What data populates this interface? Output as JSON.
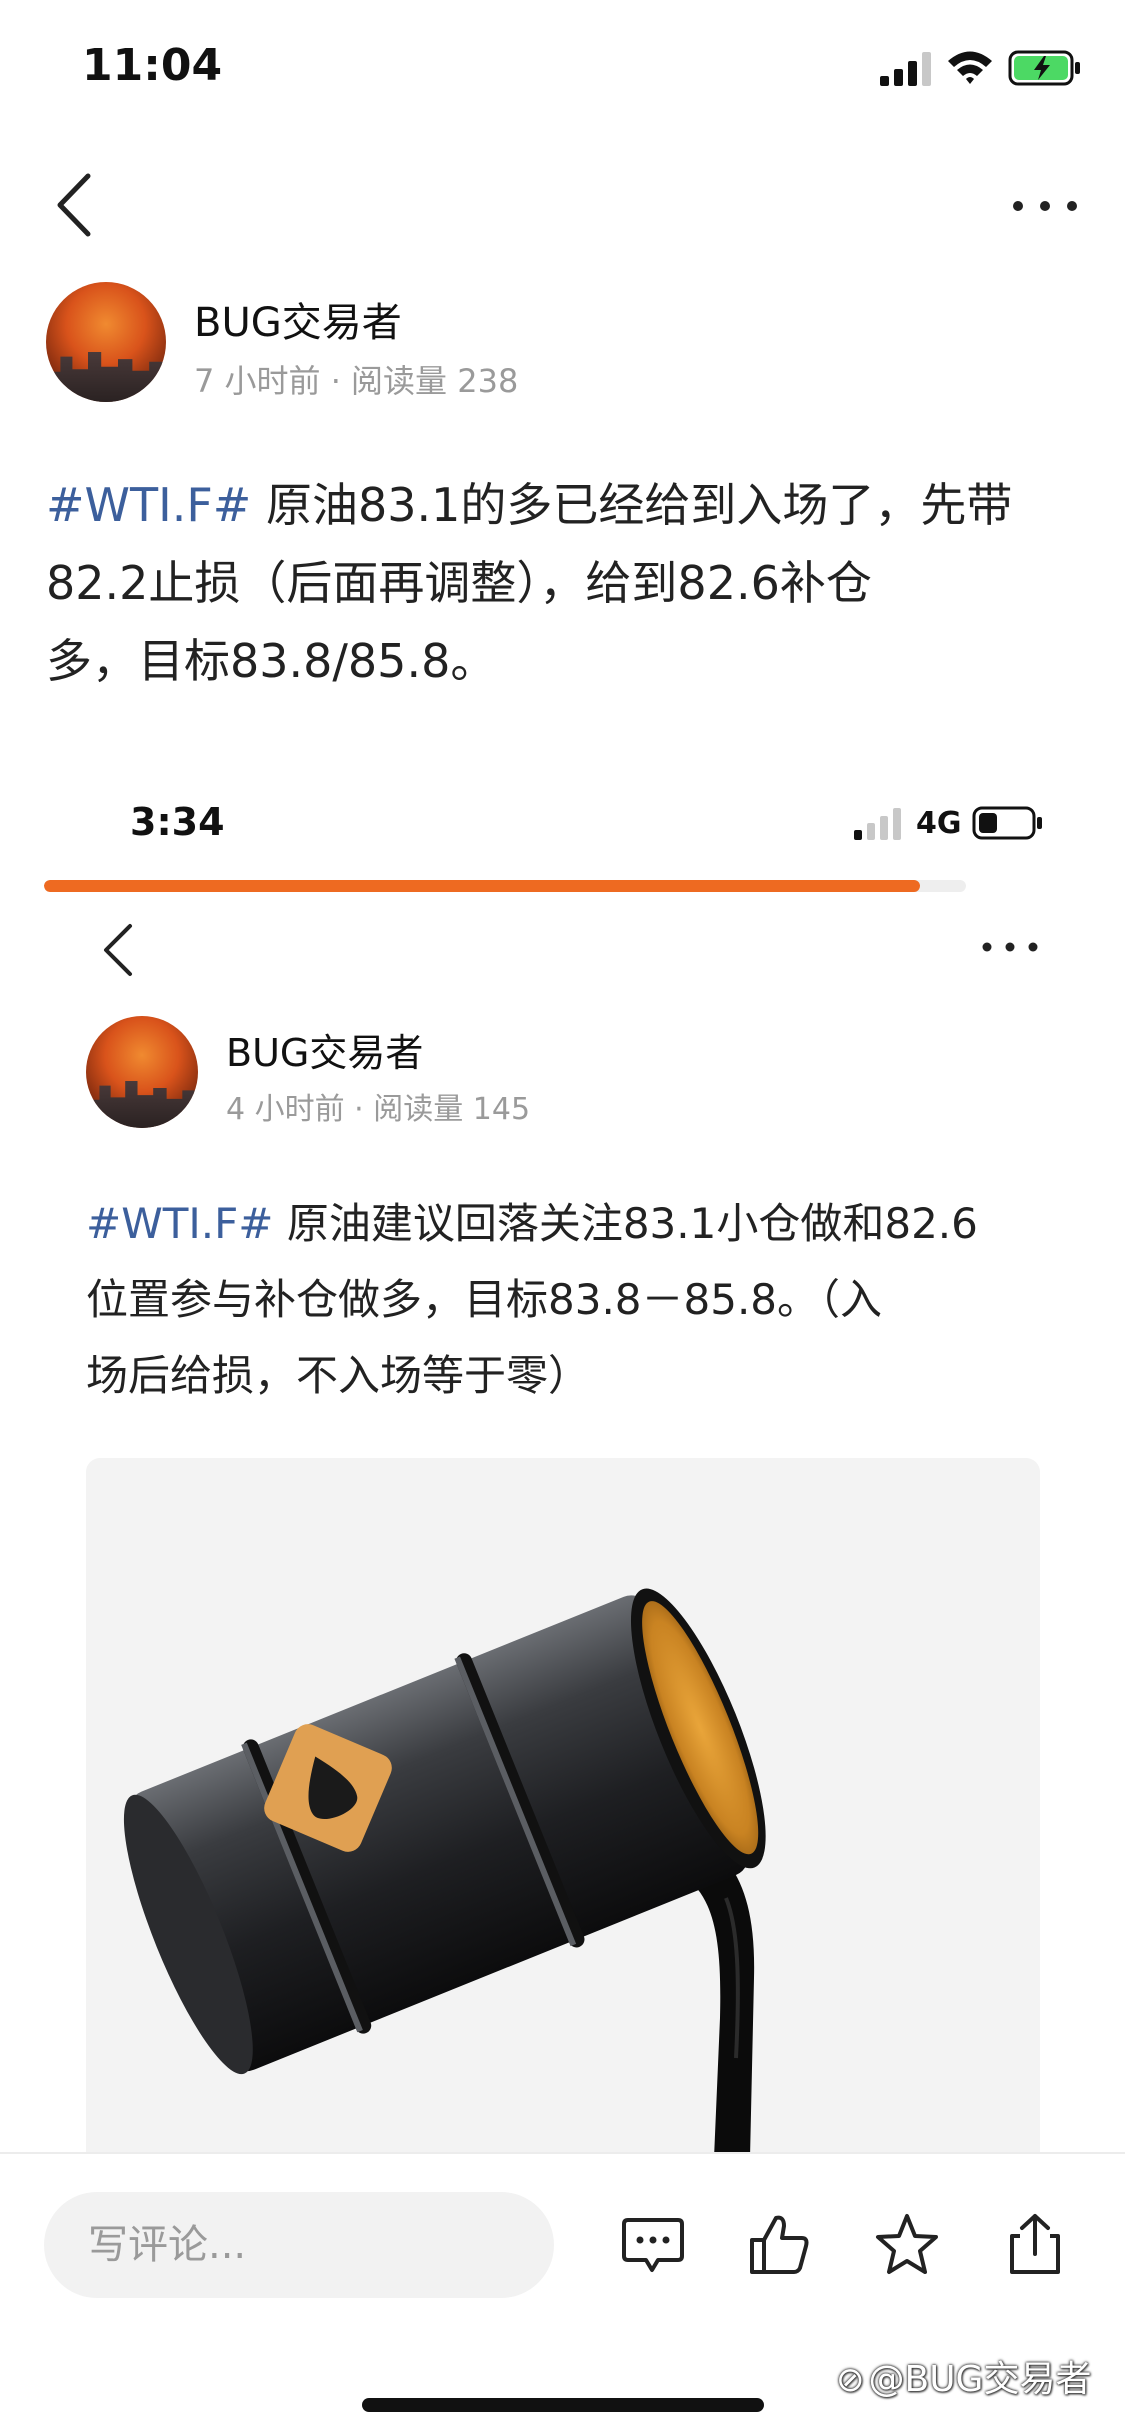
{
  "status_bar": {
    "time": "11:04"
  },
  "nav": {
    "back": "back",
    "more": "more"
  },
  "post": {
    "author": "BUG交易者",
    "meta": "7 小时前 · 阅读量 238",
    "hashtag": "#WTI.F#",
    "lines": [
      "原油83.1的多已经给到入场了，先带",
      "82.2止损（后面再调整），给到82.6补仓",
      "多，目标83.8/85.8。"
    ]
  },
  "embedded_screenshot": {
    "time": "3:34",
    "network": "4G",
    "progress": 0.95,
    "accent_color": "#ee6a21",
    "author": "BUG交易者",
    "meta": "4 小时前 · 阅读量 145",
    "hashtag": "#WTI.F#",
    "lines": [
      "原油建议回落关注83.1小仓做和82.6",
      "位置参与补仓做多，目标83.8－85.8。（入",
      "场后给损，不入场等于零）"
    ],
    "image": "oil-barrel-pouring-illustration"
  },
  "bottom_bar": {
    "comment_placeholder": "写评论...",
    "icons": [
      "comment-icon",
      "like-icon",
      "favorite-icon",
      "share-icon"
    ]
  },
  "watermark": "@BUG交易者",
  "colors": {
    "hashtag": "#3c5f9c",
    "meta": "#9a9a9a"
  }
}
